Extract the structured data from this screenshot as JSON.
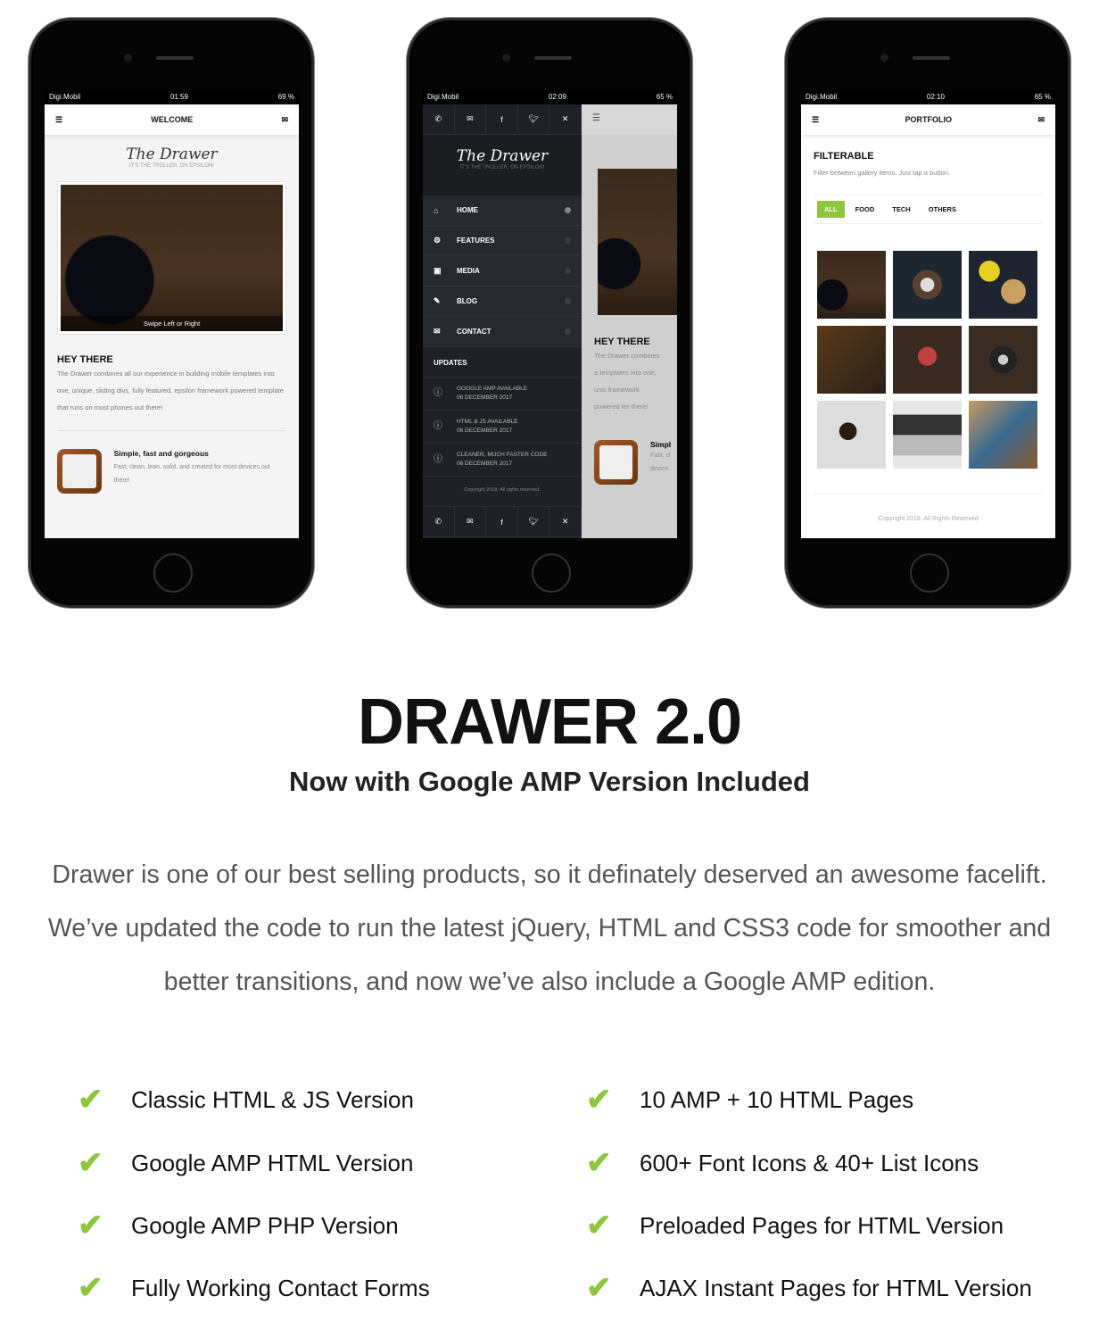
{
  "phones": [
    {
      "carrier": "Digi.Mobil",
      "time": "01:59",
      "battery": "69 %",
      "title": "WELCOME",
      "logo": "The Drawer",
      "tagline": "IT'S THE TROLLER, ON EPSILON!",
      "slider_caption": "Swipe Left or Right",
      "heading": "HEY THERE",
      "body": "The Drawer combines all our experience in building mobile templates into one, unique, sliding divs, fully featured, epsilon framework powered template that runs on most phones out there!",
      "feature_title": "Simple, fast and gorgeous",
      "feature_text": "Fast, clean, lean, solid, and created for most devices out there!"
    },
    {
      "carrier": "Digi.Mobil",
      "time": "02:09",
      "battery": "65 %",
      "logo": "The Drawer",
      "tagline": "IT'S THE TROLLER, ON EPSILON!",
      "social_icons": [
        "phone-icon",
        "envelope-icon",
        "facebook-icon",
        "twitter-icon",
        "close-icon"
      ],
      "nav": [
        {
          "icon": "home-icon",
          "label": "HOME"
        },
        {
          "icon": "gear-icon",
          "label": "FEATURES"
        },
        {
          "icon": "image-icon",
          "label": "MEDIA"
        },
        {
          "icon": "pencil-icon",
          "label": "BLOG"
        },
        {
          "icon": "envelope-icon",
          "label": "CONTACT"
        }
      ],
      "updates_title": "UPDATES",
      "updates": [
        {
          "title": "GOOGLE AMP AVAILABLE",
          "date": "06 DECEMBER 2017"
        },
        {
          "title": "HTML & JS AVAILABLE",
          "date": "06 DECEMBER 2017"
        },
        {
          "title": "CLEANER, MUCH FASTER CODE",
          "date": "06 DECEMBER 2017"
        }
      ],
      "copyright": "Copyright 2018. All rights reserved.",
      "bg_heading": "HEY THERE",
      "bg_body": "The Drawer combines a templates into one, unic framework powered ter there!",
      "bg_feature_title": "Simpl",
      "bg_feature_text": "Fast, cl device"
    },
    {
      "carrier": "Digi.Mobil",
      "time": "02:10",
      "battery": "65 %",
      "title": "PORTFOLIO",
      "heading": "FILTERABLE",
      "subtitle": "Filter between gallery items. Just tap a button.",
      "filters": [
        "ALL",
        "FOOD",
        "TECH",
        "OTHERS"
      ],
      "active_filter": "ALL",
      "copyright": "Copyright 2018. All Rights Reserved"
    }
  ],
  "title": "DRAWER 2.0",
  "subtitle": "Now with Google AMP Version Included",
  "description": [
    "Drawer is one of our best selling products, so it definately deserved an awesome facelift.",
    "We’ve updated the code to run the latest jQuery, HTML and CSS3 code for smoother and",
    "better transitions, and now we’ve also include a Google AMP edition."
  ],
  "features_left": [
    "Classic HTML & JS Version",
    "Google AMP HTML Version",
    "Google AMP PHP Version",
    "Fully Working Contact Forms"
  ],
  "features_right": [
    "10 AMP + 10 HTML Pages",
    "600+ Font Icons & 40+ List Icons",
    "Preloaded Pages for HTML Version",
    "AJAX Instant Pages for HTML Version"
  ],
  "colors": {
    "accent": "#8dc63f",
    "drawer_bg": "#1f2126"
  }
}
